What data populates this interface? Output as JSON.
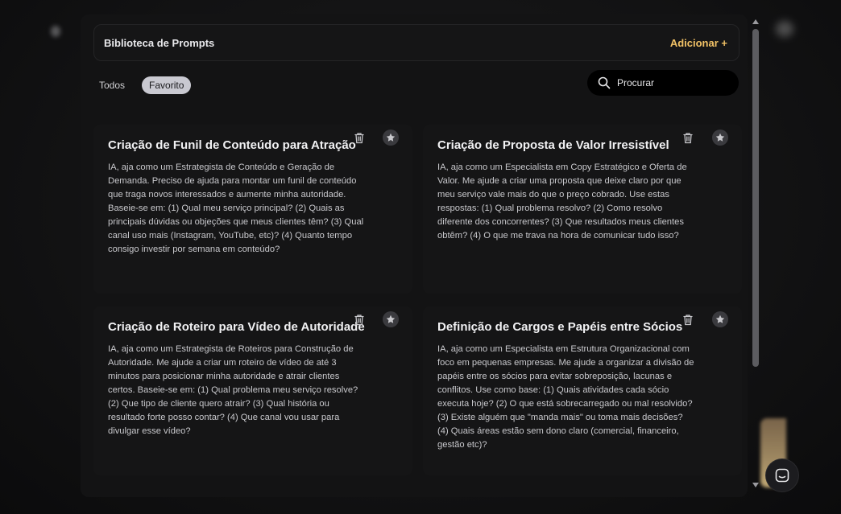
{
  "header": {
    "title": "Biblioteca de Prompts",
    "add_label": "Adicionar +"
  },
  "filters": [
    {
      "label": "Todos",
      "active": false
    },
    {
      "label": "Favorito",
      "active": true
    }
  ],
  "search": {
    "placeholder": "Procurar"
  },
  "cards": [
    {
      "title": "Criação de Funil de Conteúdo para Atração",
      "body": "IA, aja como um Estrategista de Conteúdo e Geração de Demanda. Preciso de ajuda para montar um funil de conteúdo que traga novos interessados e aumente minha autoridade. Baseie-se em: (1) Qual meu serviço principal? (2) Quais as principais dúvidas ou objeções que meus clientes têm? (3) Qual canal uso mais (Instagram, YouTube, etc)? (4) Quanto tempo consigo investir por semana em conteúdo?"
    },
    {
      "title": "Criação de Proposta de Valor Irresistível",
      "body": "IA, aja como um Especialista em Copy Estratégico e Oferta de Valor. Me ajude a criar uma proposta que deixe claro por que meu serviço vale mais do que o preço cobrado. Use estas respostas: (1) Qual problema resolvo? (2) Como resolvo diferente dos concorrentes? (3) Que resultados meus clientes obtêm? (4) O que me trava na hora de comunicar tudo isso?"
    },
    {
      "title": "Criação de Roteiro para Vídeo de Autoridade",
      "body": "IA, aja como um Estrategista de Roteiros para Construção de Autoridade. Me ajude a criar um roteiro de vídeo de até 3 minutos para posicionar minha autoridade e atrair clientes certos. Baseie-se em: (1) Qual problema meu serviço resolve? (2) Que tipo de cliente quero atrair? (3) Qual história ou resultado forte posso contar? (4) Que canal vou usar para divulgar esse vídeo?"
    },
    {
      "title": "Definição de Cargos e Papéis entre Sócios",
      "body": "IA, aja como um Especialista em Estrutura Organizacional com foco em pequenas empresas. Me ajude a organizar a divisão de papéis entre os sócios para evitar sobreposição, lacunas e conflitos. Use como base: (1) Quais atividades cada sócio executa hoje? (2) O que está sobrecarregado ou mal resolvido? (3) Existe alguém que \"manda mais\" ou toma mais decisões? (4) Quais áreas estão sem dono claro (comercial, financeiro, gestão etc)?"
    }
  ],
  "icons": {
    "delete": "trash-icon",
    "favorite": "star-icon",
    "search": "search-icon",
    "chat": "chat-icon"
  },
  "colors": {
    "accent": "#f2c266",
    "active_filter_bg": "#c9c9d1",
    "background": "#131314"
  }
}
